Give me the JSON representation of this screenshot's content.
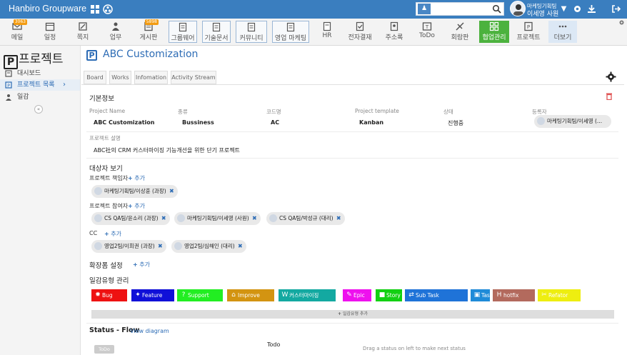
{
  "header": {
    "brand": "Hanbiro Groupware",
    "search_placeholder": "",
    "user_dept": "마케팅기획팀",
    "user_name": "이세영 사원"
  },
  "apps": [
    {
      "label": "메일",
      "badge": "3063"
    },
    {
      "label": "일정",
      "badge": ""
    },
    {
      "label": "쪽지",
      "badge": ""
    },
    {
      "label": "업무",
      "badge": ""
    },
    {
      "label": "게시판",
      "badge": "5898"
    },
    {
      "label": "그룹웨어",
      "badge": ""
    },
    {
      "label": "기술문서",
      "badge": ""
    },
    {
      "label": "커뮤니티",
      "badge": ""
    },
    {
      "label": "영업 마케팅",
      "badge": ""
    },
    {
      "label": "HR",
      "badge": ""
    },
    {
      "label": "전자결재",
      "badge": ""
    },
    {
      "label": "주소록",
      "badge": ""
    },
    {
      "label": "ToDo",
      "badge": ""
    },
    {
      "label": "회람판",
      "badge": ""
    },
    {
      "label": "협업관리",
      "badge": ""
    },
    {
      "label": "프로젝트",
      "badge": ""
    },
    {
      "label": "더보기",
      "badge": ""
    }
  ],
  "sidebar": {
    "title": "프로젝트",
    "items": [
      {
        "label": "대시보드"
      },
      {
        "label": "프로젝트 목록"
      },
      {
        "label": "일감"
      }
    ]
  },
  "page": {
    "title": "ABC Customization",
    "tabs": [
      "Board",
      "Works",
      "Infomation",
      "Activity Stream"
    ]
  },
  "basic_info": {
    "section": "기본정보",
    "labels": [
      "Project Name",
      "종류",
      "코드명",
      "Project template",
      "상태",
      "등록자"
    ],
    "values": [
      "ABC Customization",
      "Bussiness",
      "AC",
      "Kanban",
      "진행중",
      "마케팅기획팀/이세영 (..."
    ],
    "desc_label": "프로젝트 설명",
    "desc": "ABC社의 CRM 커스터마이징 기능개선을 위한 단기 프로젝트"
  },
  "members": {
    "section": "대상자 보기",
    "owner_label": "프로젝트 책임자",
    "owners": [
      "마케팅기획팀/이상훈 (과장)"
    ],
    "participants_label": "프로젝트 참여자",
    "participants": [
      "CS QA팀/윤소리 (과장)",
      "마케팅기획팀/이세영 (사원)",
      "CS QA팀/박성규 (대리)"
    ],
    "cc_label": "CC",
    "cc": [
      "영업2팀/이희권 (과장)",
      "영업2팀/심해인 (대리)"
    ],
    "add_label": "추가"
  },
  "extension": {
    "section": "확장폼 설정",
    "add_label": "추가"
  },
  "work_types": {
    "section": "일감유형 관리",
    "labels": [
      {
        "name": "Bug",
        "color": "#ee1111"
      },
      {
        "name": "Feature",
        "color": "#1010d8"
      },
      {
        "name": "Support",
        "color": "#22ee22"
      },
      {
        "name": "Improve",
        "color": "#d39411"
      },
      {
        "name": "커스터마이징",
        "color": "#13a9a1"
      },
      {
        "name": "Epic",
        "color": "#ee11ee"
      },
      {
        "name": "Story",
        "color": "#12d012"
      },
      {
        "name": "Sub Task",
        "color": "#1f73d8"
      },
      {
        "name": "Task",
        "color": "#1f8bd8"
      },
      {
        "name": "hotfix",
        "color": "#b36a5d"
      },
      {
        "name": "Refator",
        "color": "#eeee10"
      }
    ],
    "add_label": "일감유형 추가"
  },
  "flow": {
    "title": "Status - Flow",
    "link": "View diagram",
    "chip": "ToDo",
    "column": "Todo",
    "hint": "Drag a status on left to make next status"
  }
}
